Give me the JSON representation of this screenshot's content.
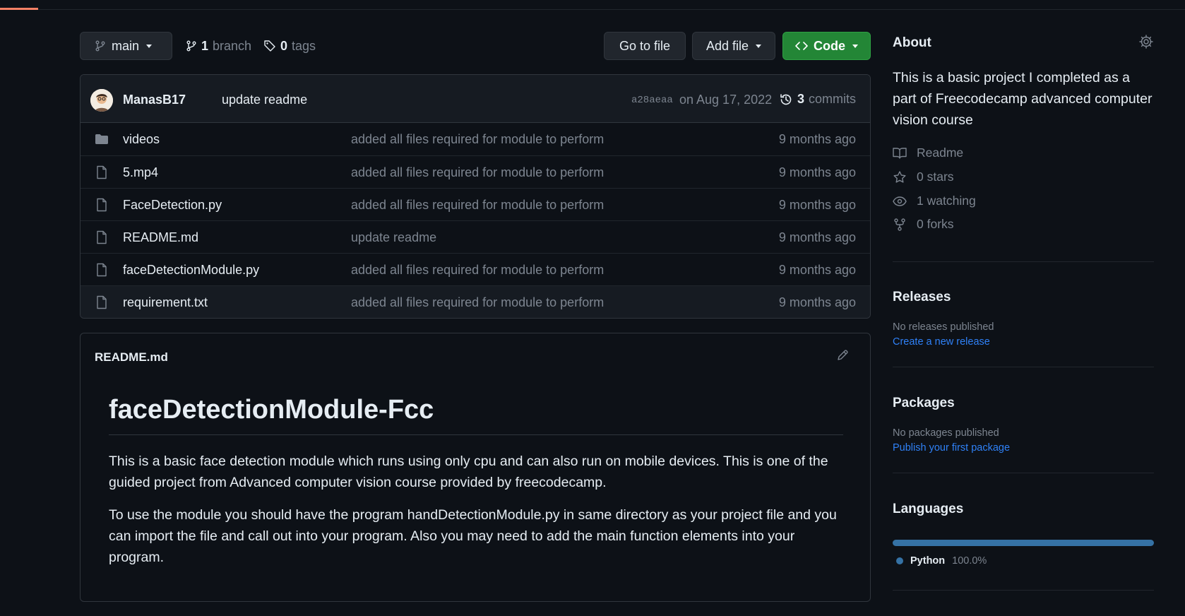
{
  "toolbar": {
    "branch_label": "main",
    "branch_count": "1",
    "branch_word": "branch",
    "tag_count": "0",
    "tag_word": "tags",
    "goto_label": "Go to file",
    "add_label": "Add file",
    "code_label": "Code"
  },
  "commit": {
    "author": "ManasB17",
    "message": "update readme",
    "hash": "a28aeaa",
    "date": "on Aug 17, 2022",
    "count": "3",
    "count_word": "commits"
  },
  "files": [
    {
      "name": "videos",
      "type": "folder-icon",
      "message": "added all files required for module to perform",
      "age": "9 months ago"
    },
    {
      "name": "5.mp4",
      "type": "file-icon",
      "message": "added all files required for module to perform",
      "age": "9 months ago"
    },
    {
      "name": "FaceDetection.py",
      "type": "file-icon",
      "message": "added all files required for module to perform",
      "age": "9 months ago"
    },
    {
      "name": "README.md",
      "type": "file-icon",
      "message": "update readme",
      "age": "9 months ago"
    },
    {
      "name": "faceDetectionModule.py",
      "type": "file-icon",
      "message": "added all files required for module to perform",
      "age": "9 months ago"
    },
    {
      "name": "requirement.txt",
      "type": "file-icon",
      "message": "added all files required for module to perform",
      "age": "9 months ago"
    }
  ],
  "readme": {
    "filename": "README.md",
    "heading": "faceDetectionModule-Fcc",
    "paragraphs": [
      "This is a basic face detection module which runs using only cpu and can also run on mobile devices. This is one of the guided project from Advanced computer vision course provided by freecodecamp.",
      "To use the module you should have the program handDetectionModule.py in same directory as your project file and you can import the file and call out into your program. Also you may need to add the main function elements into your program."
    ]
  },
  "about": {
    "heading": "About",
    "description": "This is a basic project I completed as a part of Freecodecamp advanced computer vision course",
    "readme_label": "Readme",
    "stars_count": "0",
    "stars_word": "stars",
    "watching_count": "1",
    "watching_word": "watching",
    "forks_count": "0",
    "forks_word": "forks"
  },
  "releases": {
    "heading": "Releases",
    "status": "No releases published",
    "link": "Create a new release"
  },
  "packages": {
    "heading": "Packages",
    "status": "No packages published",
    "link": "Publish your first package"
  },
  "languages": {
    "heading": "Languages",
    "items": [
      {
        "name": "Python",
        "percent": "100.0%",
        "color": "#3572a5"
      }
    ]
  },
  "colors": {
    "background": "#0d1117",
    "code_button": "#238636",
    "link": "#2f81f7",
    "muted": "#7d8590"
  }
}
